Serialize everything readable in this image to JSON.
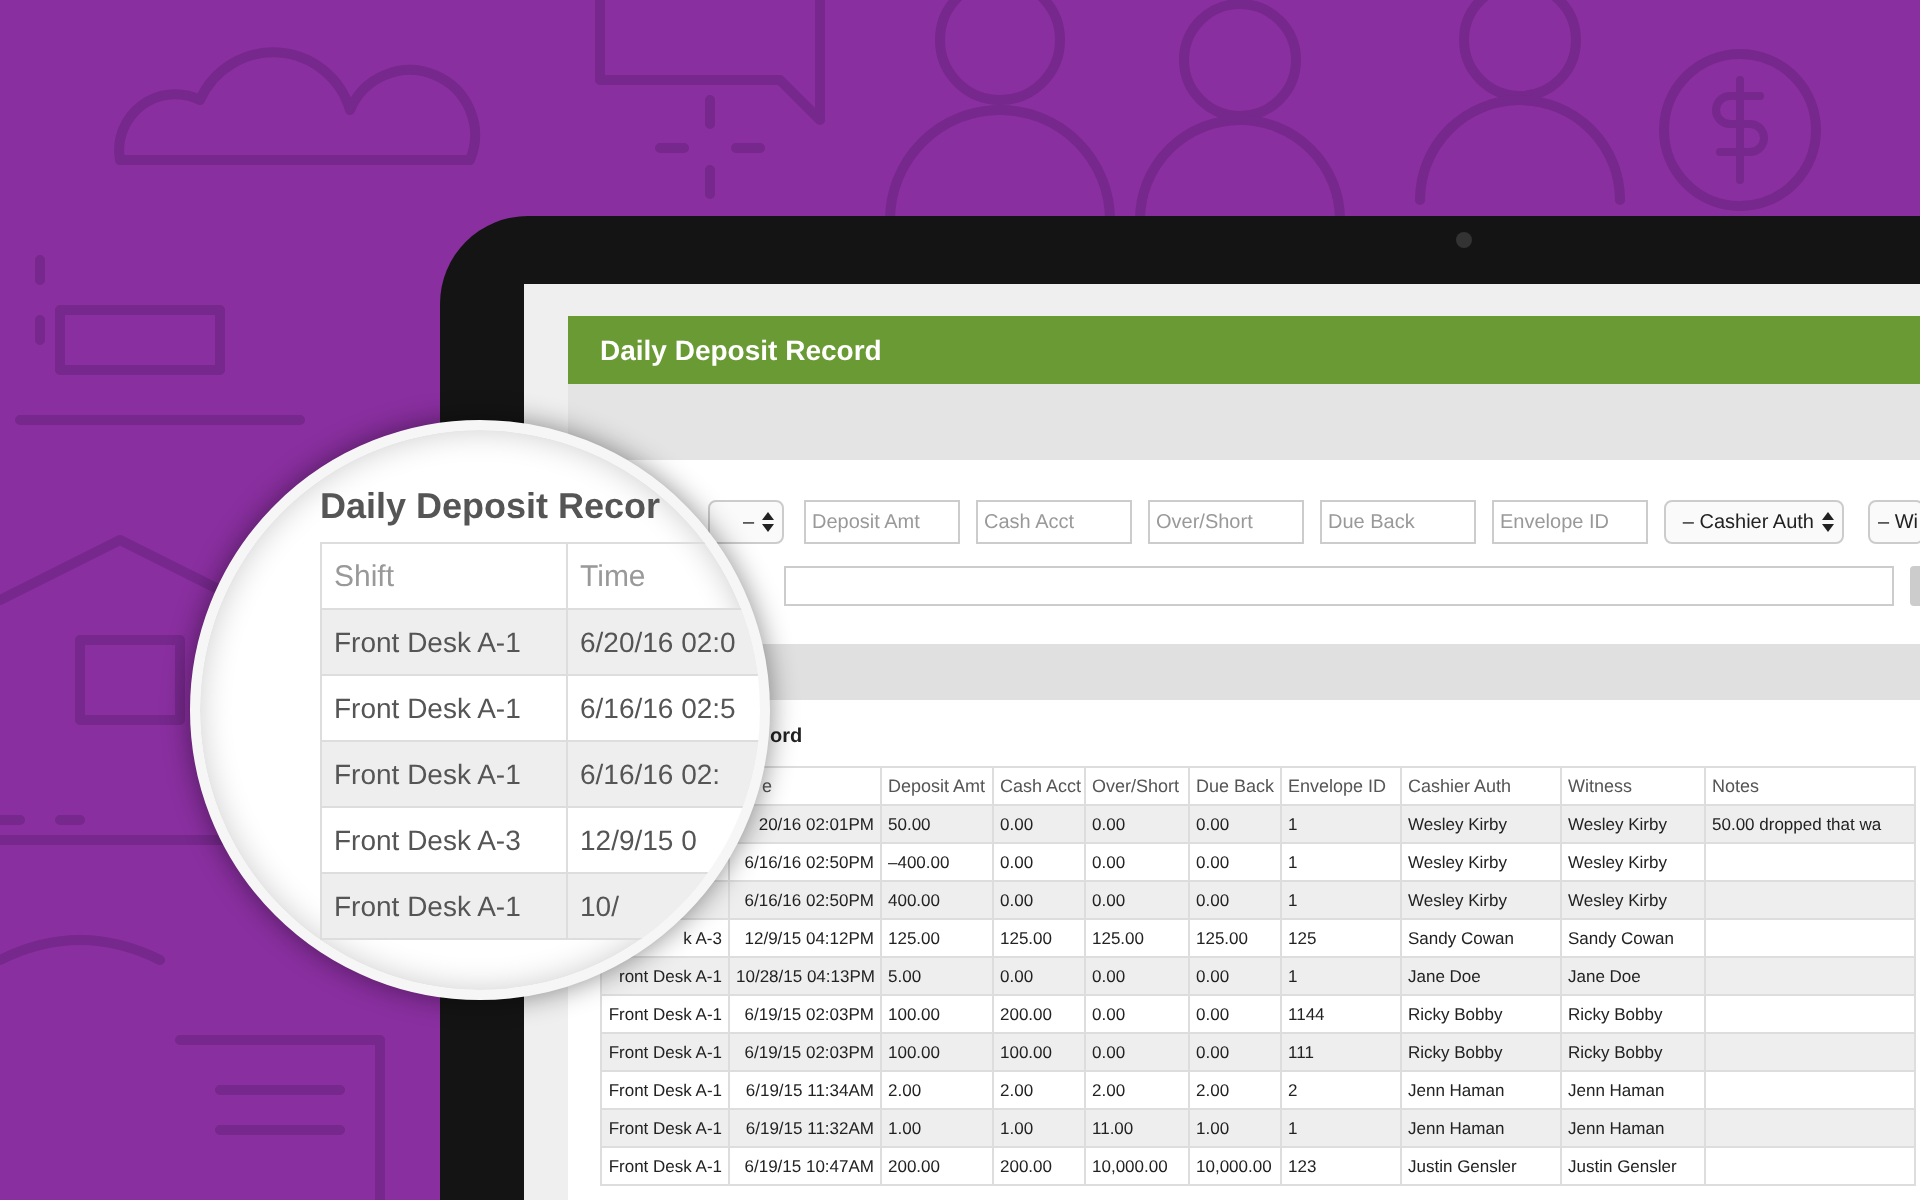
{
  "app": {
    "title": "Daily Deposit Record",
    "filters": [
      {
        "kind": "select",
        "value": "–"
      },
      {
        "kind": "input",
        "placeholder": "Deposit Amt"
      },
      {
        "kind": "input",
        "placeholder": "Cash Acct"
      },
      {
        "kind": "input",
        "placeholder": "Over/Short"
      },
      {
        "kind": "input",
        "placeholder": "Due Back"
      },
      {
        "kind": "input",
        "placeholder": "Envelope ID"
      },
      {
        "kind": "select",
        "value": "– Cashier Auth"
      },
      {
        "kind": "select",
        "value": "– Wi"
      }
    ],
    "section_heading": "ord",
    "table": {
      "columns": [
        null,
        "e",
        "Deposit Amt",
        "Cash Acct",
        "Over/Short",
        "Due Back",
        "Envelope ID",
        "Cashier Auth",
        "Witness",
        "Notes"
      ],
      "rows": [
        [
          null,
          "20/16 02:01PM",
          "50.00",
          "0.00",
          "0.00",
          "0.00",
          "1",
          "Wesley Kirby",
          "Wesley Kirby",
          "50.00 dropped that wa"
        ],
        [
          null,
          "6/16/16 02:50PM",
          "–400.00",
          "0.00",
          "0.00",
          "0.00",
          "1",
          "Wesley Kirby",
          "Wesley Kirby",
          null
        ],
        [
          null,
          "6/16/16 02:50PM",
          "400.00",
          "0.00",
          "0.00",
          "0.00",
          "1",
          "Wesley Kirby",
          "Wesley Kirby",
          null
        ],
        [
          "k A-3",
          "12/9/15 04:12PM",
          "125.00",
          "125.00",
          "125.00",
          "125.00",
          "125",
          "Sandy Cowan",
          "Sandy Cowan",
          null
        ],
        [
          "ront Desk A-1",
          "10/28/15 04:13PM",
          "5.00",
          "0.00",
          "0.00",
          "0.00",
          "1",
          "Jane Doe",
          "Jane Doe",
          null
        ],
        [
          "Front Desk A-1",
          "6/19/15 02:03PM",
          "100.00",
          "200.00",
          "0.00",
          "0.00",
          "1144",
          "Ricky Bobby",
          "Ricky Bobby",
          null
        ],
        [
          "Front Desk A-1",
          "6/19/15 02:03PM",
          "100.00",
          "100.00",
          "0.00",
          "0.00",
          "111",
          "Ricky Bobby",
          "Ricky Bobby",
          null
        ],
        [
          "Front Desk A-1",
          "6/19/15 11:34AM",
          "2.00",
          "2.00",
          "2.00",
          "2.00",
          "2",
          "Jenn Haman",
          "Jenn Haman",
          null
        ],
        [
          "Front Desk A-1",
          "6/19/15 11:32AM",
          "1.00",
          "1.00",
          "11.00",
          "1.00",
          "1",
          "Jenn Haman",
          "Jenn Haman",
          null
        ],
        [
          "Front Desk A-1",
          "6/19/15 10:47AM",
          "200.00",
          "200.00",
          "10,000.00",
          "10,000.00",
          "123",
          "Justin Gensler",
          "Justin Gensler",
          null
        ]
      ]
    }
  },
  "magnifier": {
    "heading": "Daily Deposit Recor",
    "columns": [
      "Shift",
      "Time"
    ],
    "rows": [
      [
        "Front Desk A-1",
        "6/20/16 02:0"
      ],
      [
        "Front Desk A-1",
        "6/16/16 02:5"
      ],
      [
        "Front Desk A-1",
        "6/16/16 02:"
      ],
      [
        "Front Desk A-3",
        "12/9/15 0"
      ],
      [
        "Front Desk A-1",
        "10/"
      ]
    ]
  }
}
